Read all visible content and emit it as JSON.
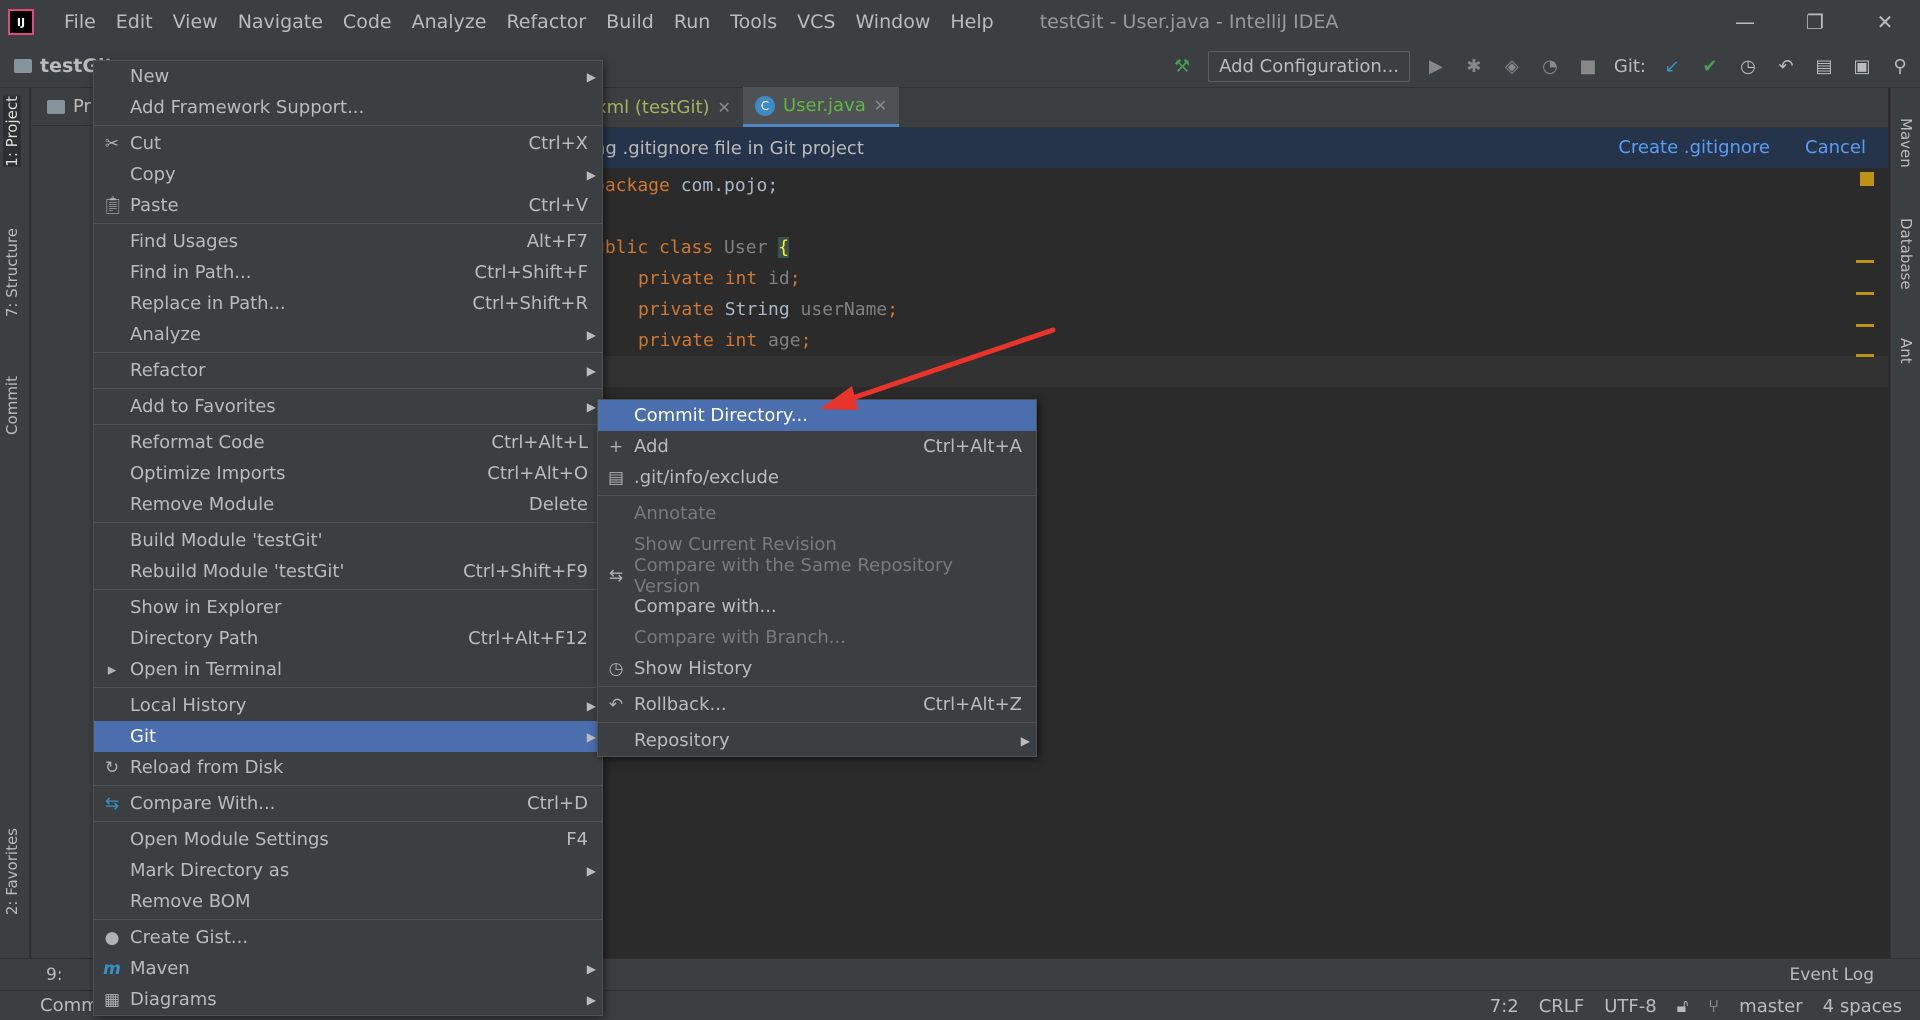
{
  "window": {
    "app_logo": "IJ",
    "title": "testGit - User.java - IntelliJ IDEA",
    "menu": [
      "File",
      "Edit",
      "View",
      "Navigate",
      "Code",
      "Analyze",
      "Refactor",
      "Build",
      "Run",
      "Tools",
      "VCS",
      "Window",
      "Help"
    ],
    "controls": {
      "minimize": "—",
      "restore": "❐",
      "close": "✕"
    }
  },
  "toolbar": {
    "breadcrumb": "testGit",
    "add_configuration": "Add Configuration...",
    "git_label": "Git:"
  },
  "left_strip": {
    "project": "1: Project",
    "structure": "7: Structure",
    "commit": "Commit",
    "favorites": "2: Favorites"
  },
  "right_strip": {
    "maven": "Maven",
    "database": "Database",
    "ant": "Ant"
  },
  "project_panel": {
    "title": "Pr"
  },
  "tabs": [
    {
      "label": "xml (testGit)",
      "active": false
    },
    {
      "label": "User.java",
      "active": true,
      "icon": "C"
    }
  ],
  "banner": {
    "text": "ng .gitignore file in Git project",
    "create": "Create .gitignore",
    "cancel": "Cancel"
  },
  "code": {
    "line1_kw": "package",
    "line1_rest": " com.pojo;",
    "line2_kw": "ublic class",
    "line2_name": " User ",
    "line2_brace": "{",
    "line3_kw": "private int",
    "line3_id": " id",
    "line3_end": ";",
    "line4_kw": "private",
    "line4_type": " String",
    "line4_id": " userName",
    "line4_end": ";",
    "line5_kw": "private int",
    "line5_id": " age",
    "line5_end": ";"
  },
  "context_menu": [
    {
      "label": "New",
      "submenu": true
    },
    {
      "label": "Add Framework Support..."
    },
    {
      "sep": true
    },
    {
      "label": "Cut",
      "shortcut": "Ctrl+X",
      "icon": "scissors-icon"
    },
    {
      "label": "Copy",
      "submenu": true
    },
    {
      "label": "Paste",
      "shortcut": "Ctrl+V",
      "icon": "clipboard-icon"
    },
    {
      "sep": true
    },
    {
      "label": "Find Usages",
      "shortcut": "Alt+F7"
    },
    {
      "label": "Find in Path...",
      "shortcut": "Ctrl+Shift+F"
    },
    {
      "label": "Replace in Path...",
      "shortcut": "Ctrl+Shift+R"
    },
    {
      "label": "Analyze",
      "submenu": true
    },
    {
      "sep": true
    },
    {
      "label": "Refactor",
      "submenu": true
    },
    {
      "sep": true
    },
    {
      "label": "Add to Favorites",
      "submenu": true
    },
    {
      "sep": true
    },
    {
      "label": "Reformat Code",
      "shortcut": "Ctrl+Alt+L"
    },
    {
      "label": "Optimize Imports",
      "shortcut": "Ctrl+Alt+O"
    },
    {
      "label": "Remove Module",
      "shortcut": "Delete"
    },
    {
      "sep": true
    },
    {
      "label": "Build Module 'testGit'"
    },
    {
      "label": "Rebuild Module 'testGit'",
      "shortcut": "Ctrl+Shift+F9"
    },
    {
      "sep": true
    },
    {
      "label": "Show in Explorer"
    },
    {
      "label": "Directory Path",
      "shortcut": "Ctrl+Alt+F12"
    },
    {
      "label": "Open in Terminal",
      "icon": "terminal-icon"
    },
    {
      "sep": true
    },
    {
      "label": "Local History",
      "submenu": true
    },
    {
      "label": "Git",
      "submenu": true,
      "selected": true
    },
    {
      "label": "Reload from Disk",
      "icon": "reload-icon"
    },
    {
      "sep": true
    },
    {
      "label": "Compare With...",
      "shortcut": "Ctrl+D",
      "icon": "compare-icon"
    },
    {
      "sep": true
    },
    {
      "label": "Open Module Settings",
      "shortcut": "F4"
    },
    {
      "label": "Mark Directory as",
      "submenu": true
    },
    {
      "label": "Remove BOM"
    },
    {
      "sep": true
    },
    {
      "label": "Create Gist...",
      "icon": "github-icon"
    },
    {
      "label": "Maven",
      "submenu": true,
      "icon": "maven-icon"
    },
    {
      "label": "Diagrams",
      "submenu": true,
      "icon": "diagram-icon"
    }
  ],
  "git_submenu": [
    {
      "label": "Commit Directory...",
      "selected": true
    },
    {
      "label": "Add",
      "shortcut": "Ctrl+Alt+A",
      "icon": "plus-icon"
    },
    {
      "label": ".git/info/exclude",
      "icon": "file-exclude-icon"
    },
    {
      "sep": true
    },
    {
      "label": "Annotate",
      "disabled": true
    },
    {
      "label": "Show Current Revision",
      "disabled": true
    },
    {
      "label": "Compare with the Same Repository Version",
      "disabled": true,
      "icon": "compare-icon"
    },
    {
      "label": "Compare with..."
    },
    {
      "label": "Compare with Branch...",
      "disabled": true
    },
    {
      "label": "Show History",
      "icon": "clock-icon"
    },
    {
      "sep": true
    },
    {
      "label": "Rollback...",
      "shortcut": "Ctrl+Alt+Z",
      "icon": "undo-icon"
    },
    {
      "sep": true
    },
    {
      "label": "Repository",
      "submenu": true
    }
  ],
  "bottom_tools": {
    "tool_9": "9:",
    "event_log": "Event Log"
  },
  "status": {
    "left": "Comm",
    "position": "7:2",
    "line_sep": "CRLF",
    "encoding": "UTF-8",
    "branch": "master",
    "indent": "4 spaces"
  },
  "colors": {
    "selection": "#4b6eaf",
    "menu_bg": "#3c3f41",
    "editor_bg": "#2b2b2b",
    "keyword": "#cc7832",
    "link": "#589df6",
    "arrow": "#e8342b"
  }
}
